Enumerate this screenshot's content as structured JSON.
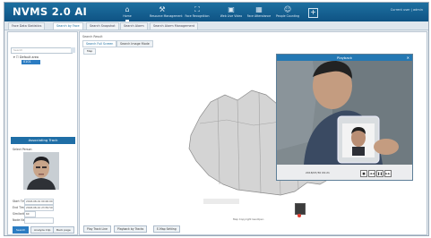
{
  "app": {
    "title": "NVMS 2.0 AI",
    "user_text": "Current user  |  admin"
  },
  "header": {
    "nav": [
      {
        "label": "Home",
        "icon": "home-icon"
      },
      {
        "label": "Resource Management",
        "icon": "tools-icon"
      },
      {
        "label": "Face Recognition",
        "icon": "face-icon"
      },
      {
        "label": "Web Live Video",
        "icon": "camera-icon"
      },
      {
        "label": "Face Attendance",
        "icon": "calendar-icon"
      },
      {
        "label": "People Counting",
        "icon": "people-icon"
      }
    ],
    "add_label": "+"
  },
  "tabs": [
    "Face Data Statistics",
    "Search by Face",
    "Search Snapshot",
    "Search Alarm",
    "Search Alarm Management"
  ],
  "left_panel": {
    "search_placeholder": "Search",
    "tree_root": "Default area",
    "tree_selected": "0101",
    "section_title": "Associating Track",
    "face_label": "Select Person",
    "fields": [
      {
        "label": "Start Time",
        "value": "2018-08-01 00:00:00"
      },
      {
        "label": "End Time",
        "value": "2018-08-10 23:59:59"
      },
      {
        "label": "Similarity",
        "value": "60"
      },
      {
        "label": "Node Name",
        "value": ""
      }
    ],
    "buttons": [
      "Search",
      "Analyze Clip",
      "Back page"
    ]
  },
  "main": {
    "breadcrumb": "Search Result",
    "subtabs": [
      "Search Full Screen",
      "Search Image Mode"
    ],
    "mini_button": "Map",
    "map_copyright": "Map Copyright GeoOpen",
    "bottom_buttons": [
      "Play Track Line",
      "Playback by Tracks",
      "E-Map Setting"
    ]
  },
  "playback": {
    "title": "Playback",
    "timestamp": "2018/07/30 09:21",
    "controls": [
      "■",
      "◄◄",
      "❚❚",
      "►►"
    ]
  }
}
